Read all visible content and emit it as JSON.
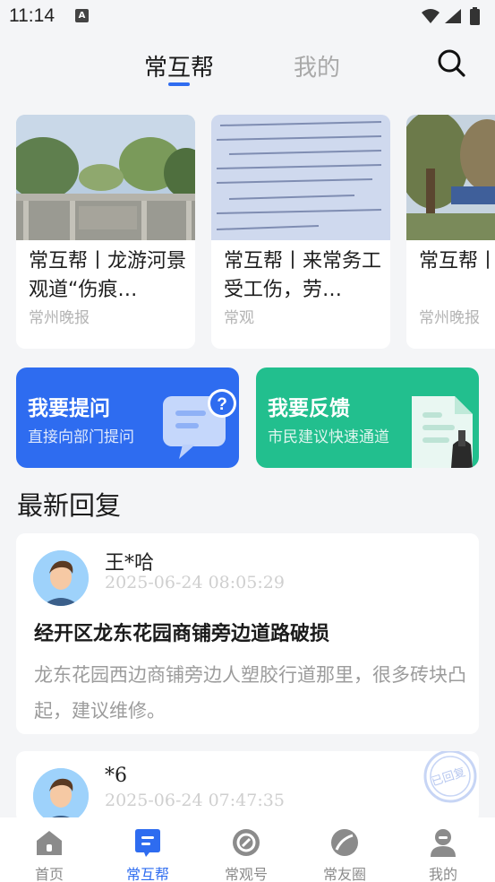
{
  "status": {
    "time": "11:14",
    "a_badge": "A"
  },
  "topnav": {
    "tabs": [
      {
        "label": "常互帮",
        "active": true
      },
      {
        "label": "我的",
        "active": false
      }
    ],
    "accent": "#2f6cf0"
  },
  "news": [
    {
      "title": "常互帮丨龙游河景观道“伤痕…",
      "source": "常州晚报",
      "image": "bridge-photo"
    },
    {
      "title": "常互帮丨来常务工受工伤，劳…",
      "source": "常观",
      "image": "document-photo"
    },
    {
      "title": "常互帮丨聘引发争",
      "source": "常州晚报",
      "image": "trees-photo"
    }
  ],
  "actions": {
    "ask": {
      "title": "我要提问",
      "subtitle": "直接向部门提问",
      "color": "#2e6cf0"
    },
    "feedback": {
      "title": "我要反馈",
      "subtitle": "市民建议快速通道",
      "color": "#22bf8e"
    }
  },
  "section_title": "最新回复",
  "replies": [
    {
      "user": "王*哈",
      "time": "2025-06-24 08:05:29",
      "title": "经开区龙东花园商铺旁边道路破损",
      "body": "龙东花园西边商铺旁边人塑胶行道那里，很多砖块凸起，建议维修。"
    },
    {
      "user": "*6",
      "time": "2025-06-24 07:47:35",
      "stamp": "已回复"
    }
  ],
  "bottomnav": [
    {
      "label": "首页",
      "icon": "home-icon",
      "active": false
    },
    {
      "label": "常互帮",
      "icon": "message-icon",
      "active": true
    },
    {
      "label": "常观号",
      "icon": "compass-icon",
      "active": false
    },
    {
      "label": "常友圈",
      "icon": "leaf-icon",
      "active": false
    },
    {
      "label": "我的",
      "icon": "person-icon",
      "active": false
    }
  ]
}
